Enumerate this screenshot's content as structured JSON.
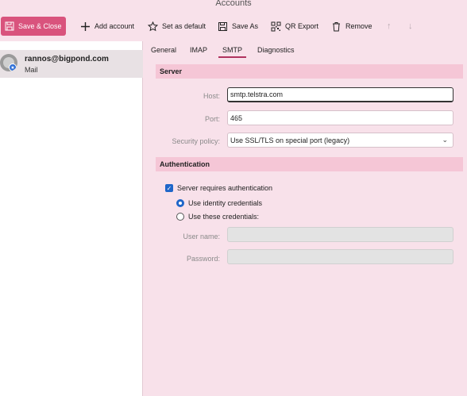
{
  "window": {
    "title": "Accounts"
  },
  "toolbar": {
    "save_close": "Save & Close",
    "add_account": "Add account",
    "set_default": "Set as default",
    "save_as": "Save As",
    "qr_export": "QR Export",
    "remove": "Remove",
    "up_arrow": "↑",
    "down_arrow": "↓"
  },
  "accounts": [
    {
      "email": "rannos@bigpond.com",
      "type": "Mail"
    }
  ],
  "tabs": [
    "General",
    "IMAP",
    "SMTP",
    "Diagnostics"
  ],
  "active_tab": "SMTP",
  "server": {
    "header": "Server",
    "host_label": "Host:",
    "host_value": "smtp.telstra.com",
    "port_label": "Port:",
    "port_value": "465",
    "security_label": "Security policy:",
    "security_value": "Use SSL/TLS on special port (legacy)"
  },
  "auth": {
    "header": "Authentication",
    "requires_auth": "Server requires authentication",
    "requires_auth_checked": true,
    "use_identity": "Use identity credentials",
    "use_these": "Use these credentials:",
    "selected": "use_identity",
    "username_label": "User name:",
    "username_value": "",
    "password_label": "Password:",
    "password_value": ""
  },
  "colors": {
    "accent": "#d9537d",
    "section": "#f5c6d6",
    "background": "#f8e1ea",
    "selection": "#1f66c9"
  }
}
